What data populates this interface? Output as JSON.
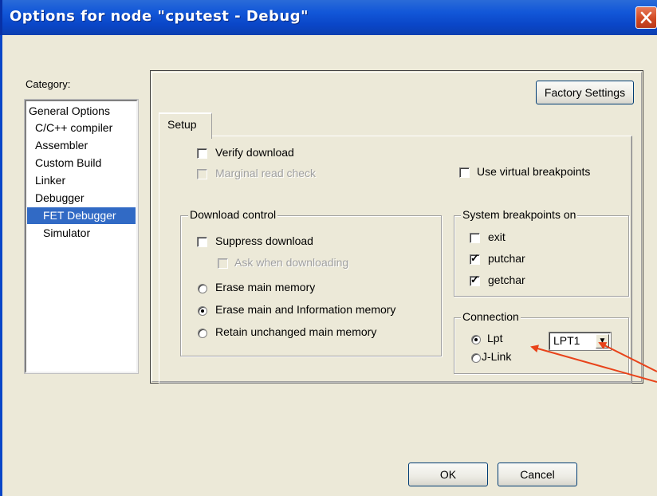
{
  "window": {
    "title": "Options for node \"cputest - Debug\"",
    "close_glyph": "✕"
  },
  "category": {
    "label": "Category:",
    "items": [
      {
        "label": "General Options"
      },
      {
        "label": "C/C++ compiler"
      },
      {
        "label": "Assembler"
      },
      {
        "label": "Custom Build"
      },
      {
        "label": "Linker"
      },
      {
        "label": "Debugger"
      },
      {
        "label": "FET Debugger",
        "selected": true
      },
      {
        "label": "Simulator"
      }
    ]
  },
  "factory_settings_label": "Factory Settings",
  "tabs": [
    {
      "label": "Setup",
      "active": true
    }
  ],
  "setup": {
    "verify_download": {
      "label": "Verify download",
      "checked": false
    },
    "marginal_read_check": {
      "label": "Marginal read check",
      "checked": false,
      "disabled": true
    },
    "use_virtual_breakpoints": {
      "label": "Use virtual breakpoints",
      "checked": false
    },
    "download_control": {
      "title": "Download control",
      "suppress_download": {
        "label": "Suppress download",
        "checked": false
      },
      "ask_when_downloading": {
        "label": "Ask when downloading",
        "checked": false,
        "disabled": true
      },
      "erase_main_memory": {
        "label": "Erase main memory",
        "selected": false
      },
      "erase_main_and_info": {
        "label": "Erase main and Information memory",
        "selected": true
      },
      "retain_unchanged": {
        "label": "Retain unchanged main memory",
        "selected": false
      }
    },
    "system_breakpoints": {
      "title": "System breakpoints on",
      "exit": {
        "label": "exit",
        "checked": false
      },
      "putchar": {
        "label": "putchar",
        "checked": true
      },
      "getchar": {
        "label": "getchar",
        "checked": true
      }
    },
    "connection": {
      "title": "Connection",
      "lpt": {
        "label": "Lpt",
        "selected": true
      },
      "jlink": {
        "label": "J-Link",
        "selected": false
      },
      "port_value": "LPT1"
    }
  },
  "buttons": {
    "ok": "OK",
    "cancel": "Cancel"
  },
  "colors": {
    "annotation_arrow": "#e8431a",
    "selection": "#316ac5",
    "titlebar": "#0a46c8"
  },
  "check_glyph": "✓",
  "dropdown_glyph": "▼"
}
